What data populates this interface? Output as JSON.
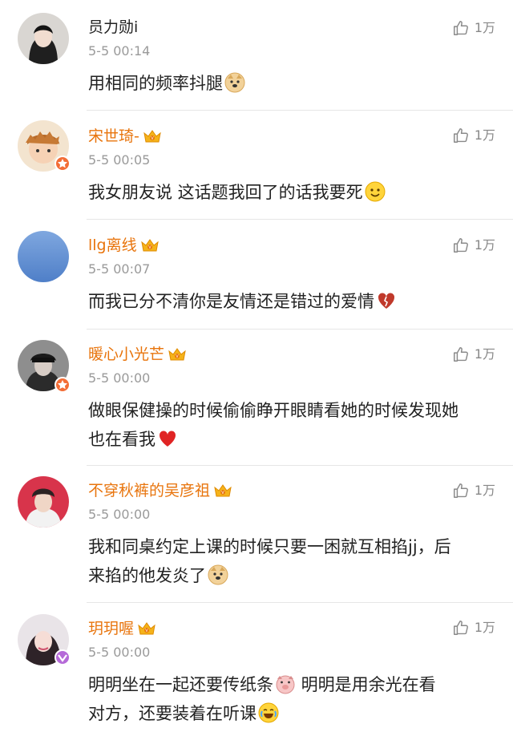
{
  "colors": {
    "username_vip": "#e8740c",
    "username_plain": "#222222",
    "timestamp": "#9a9a9a",
    "divider": "#e6e6e6"
  },
  "like_icon": "thumbs-up-icon",
  "comments": [
    {
      "username": "员力勋i",
      "time": "5-5 00:14",
      "likes": "1万",
      "text": "用相同的频率抖腿",
      "emoji": "doge-emoji"
    },
    {
      "username": "宋世琦-",
      "time": "5-5 00:05",
      "likes": "1万",
      "text": "我女朋友说 这话题我回了的话我要死",
      "emoji": "smile-emoji"
    },
    {
      "username": "llg离线",
      "time": "5-5 00:07",
      "likes": "1万",
      "text": "而我已分不清你是友情还是错过的爱情",
      "emoji": "broken-heart-emoji"
    },
    {
      "username": "暖心小光芒",
      "time": "5-5 00:00",
      "likes": "1万",
      "text_line1": "做眼保健操的时候偷偷睁开眼睛看她的时候发现她",
      "text_line2": "也在看我",
      "emoji": "heart-emoji"
    },
    {
      "username": "不穿秋裤的吴彦祖",
      "time": "5-5 00:00",
      "likes": "1万",
      "text_line1": "我和同桌约定上课的时候只要一困就互相掐jj，后",
      "text_line2": "来掐的他发炎了",
      "emoji": "doge-emoji"
    },
    {
      "username": "玥玥喔",
      "time": "5-5 00:00",
      "likes": "1万",
      "text_line1_a": "明明坐在一起还要传纸条",
      "text_line1_b": " 明明是用余光在看",
      "text_line2": "对方，还要装着在听课",
      "emoji_mid": "shy-pig-emoji",
      "emoji": "laugh-cry-emoji"
    }
  ]
}
